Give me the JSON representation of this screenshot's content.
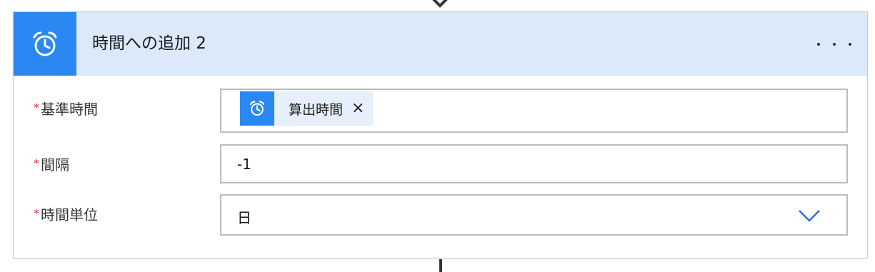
{
  "header": {
    "title": "時間への追加 2",
    "icon": "alarm-clock-icon",
    "more_icon": "more-options-icon"
  },
  "fields": {
    "base_time": {
      "label": "基準時間",
      "required_mark": "*",
      "token": {
        "label": "算出時間",
        "remove_label": "×",
        "icon": "alarm-clock-icon"
      }
    },
    "interval": {
      "label": "間隔",
      "required_mark": "*",
      "value": "-1"
    },
    "time_unit": {
      "label": "時間単位",
      "required_mark": "*",
      "value": "日",
      "dropdown_icon": "chevron-down-icon"
    }
  },
  "colors": {
    "accent": "#2b88f2",
    "header_bg": "#dce9fb",
    "required": "#d13438",
    "chevron": "#2b6fd6"
  }
}
